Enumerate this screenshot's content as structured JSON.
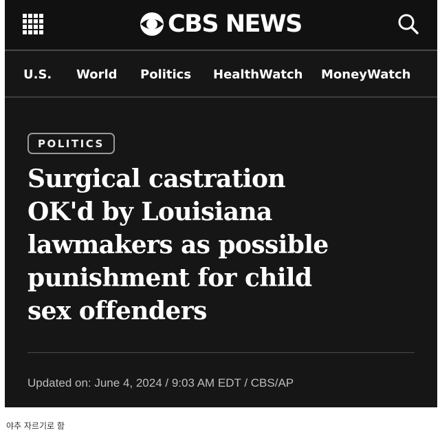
{
  "header": {
    "brand": "CBS NEWS",
    "menu_icon": "grid-menu-icon",
    "search_icon": "search-icon"
  },
  "nav": {
    "items": [
      {
        "label": "U.S."
      },
      {
        "label": "World"
      },
      {
        "label": "Politics"
      },
      {
        "label": "HealthWatch"
      },
      {
        "label": "MoneyWatch"
      }
    ]
  },
  "article": {
    "category": "POLITICS",
    "headline_lines": [
      "Surgical castration",
      "OK'd by Louisiana",
      "lawmakers as possible",
      "punishment for child",
      "sex offenders"
    ],
    "byline": "Updated on: June 4, 2024 / 9:03 AM EDT / CBS/AP"
  },
  "caption": "야추 자르기로 함",
  "colors": {
    "background": "#161616",
    "text": "#ffffff",
    "muted_text": "#bdbdbd",
    "divider": "#4a4a4a"
  }
}
